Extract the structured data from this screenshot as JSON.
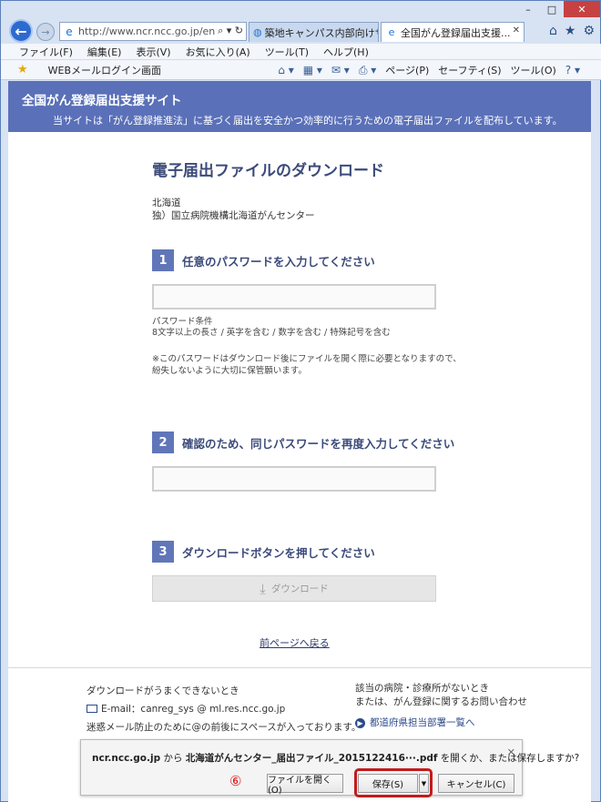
{
  "browser": {
    "address": "http://www.ncr.ncc.go.jp/en",
    "tabs": [
      {
        "label": "築地キャンパス内部向けサー..."
      },
      {
        "label": "全国がん登録届出支援..."
      }
    ],
    "menu": [
      "ファイル(F)",
      "編集(E)",
      "表示(V)",
      "お気に入り(A)",
      "ツール(T)",
      "ヘルプ(H)"
    ],
    "favorites_link": "WEBメールログイン画面",
    "cmd": {
      "page": "ページ(P)",
      "safety": "セーフティ(S)",
      "tools": "ツール(O)"
    }
  },
  "site": {
    "title": "全国がん登録届出支援サイト",
    "subtitle": "当サイトは「がん登録推進法」に基づく届出を安全かつ効率的に行うための電子届出ファイルを配布しています。"
  },
  "main": {
    "page_title": "電子届出ファイルのダウンロード",
    "prefecture": "北海道",
    "institution": "独）国立病院機構北海道がんセンター",
    "steps": [
      {
        "num": "1",
        "label": "任意のパスワードを入力してください"
      },
      {
        "num": "2",
        "label": "確認のため、同じパスワードを再度入力してください"
      },
      {
        "num": "3",
        "label": "ダウンロードボタンを押してください"
      }
    ],
    "pw_condition_title": "パスワード条件",
    "pw_condition": "8文字以上の長さ / 英字を含む / 数字を含む / 特殊記号を含む",
    "note_line1": "※このパスワードはダウンロード後にファイルを開く際に必要となりますので、",
    "note_line2": "紛失しないように大切に保管願います。",
    "download_label": "ダウンロード",
    "back_link": "前ページへ戻る"
  },
  "footer": {
    "trouble": "ダウンロードがうまくできないとき",
    "email": "E-mail：canreg_sys @ ml.res.ncc.go.jp",
    "spam_note": "迷惑メール防止のために@の前後にスペースが入っております。",
    "no_hospital": "該当の病院・診療所がないとき",
    "inquiry": "または、がん登録に関するお問い合わせ",
    "pref_link": "都道府県担当部署一覧へ"
  },
  "notification": {
    "host": "ncr.ncc.go.jp",
    "from": " から ",
    "filename": "北海道がんセンター_届出ファイル_2015122416···.pdf",
    "question": " を開くか、または保存しますか?",
    "marker": "⑥",
    "open": "ファイルを開く(O)",
    "save": "保存(S)",
    "cancel": "キャンセル(C)"
  }
}
